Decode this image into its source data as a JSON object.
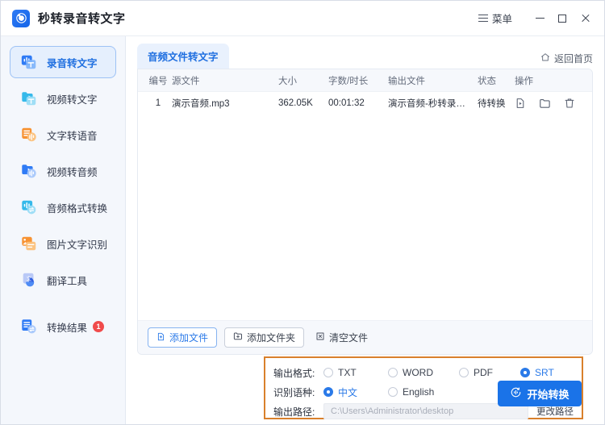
{
  "window": {
    "app_title": "秒转录音转文字",
    "logo_icon": "app-logo-icon",
    "menu_label": "菜单",
    "menu_icon": "hamburger-icon",
    "minimize_icon": "minimize-icon",
    "maximize_icon": "maximize-icon",
    "close_icon": "close-icon"
  },
  "sidebar": {
    "items": [
      {
        "label": "录音转文字",
        "icon": "audio-to-text-icon",
        "active": true
      },
      {
        "label": "视频转文字",
        "icon": "video-to-text-icon",
        "active": false
      },
      {
        "label": "文字转语音",
        "icon": "text-to-speech-icon",
        "active": false
      },
      {
        "label": "视频转音频",
        "icon": "video-to-audio-icon",
        "active": false
      },
      {
        "label": "音频格式转换",
        "icon": "audio-format-convert-icon",
        "active": false
      },
      {
        "label": "图片文字识别",
        "icon": "image-ocr-icon",
        "active": false
      },
      {
        "label": "翻译工具",
        "icon": "translate-icon",
        "active": false
      },
      {
        "label": "转换结果",
        "icon": "results-icon",
        "active": false,
        "badge": "1"
      }
    ]
  },
  "main": {
    "tab_label": "音频文件转文字",
    "home_link_label": "返回首页",
    "home_icon": "home-icon",
    "table": {
      "columns": [
        "编号",
        "源文件",
        "大小",
        "字数/时长",
        "输出文件",
        "状态",
        "操作"
      ],
      "rows": [
        {
          "no": "1",
          "source": "演示音频.mp3",
          "size": "362.05K",
          "duration": "00:01:32",
          "output": "演示音频-秒转录音转文字...",
          "status": "待转换",
          "actions": [
            "play-file-icon",
            "open-folder-icon",
            "delete-icon"
          ]
        }
      ]
    },
    "buttons": {
      "add_file": "添加文件",
      "add_file_icon": "add-file-icon",
      "add_folder": "添加文件夹",
      "add_folder_icon": "add-folder-icon",
      "clear_files": "清空文件",
      "clear_files_icon": "clear-files-icon"
    }
  },
  "options": {
    "format_label": "输出格式:",
    "formats": [
      {
        "label": "TXT",
        "selected": false
      },
      {
        "label": "WORD",
        "selected": false
      },
      {
        "label": "PDF",
        "selected": false
      },
      {
        "label": "SRT",
        "selected": true
      }
    ],
    "language_label": "识别语种:",
    "languages": [
      {
        "label": "中文",
        "selected": true
      },
      {
        "label": "English",
        "selected": false
      }
    ],
    "path_label": "输出路径:",
    "path_placeholder": "C:\\Users\\Administrator\\desktop",
    "change_path_label": "更改路径",
    "highlight_color": "#d9802c"
  },
  "action": {
    "start_label": "开始转换",
    "start_icon": "convert-icon",
    "accent_color": "#1a73e8"
  }
}
